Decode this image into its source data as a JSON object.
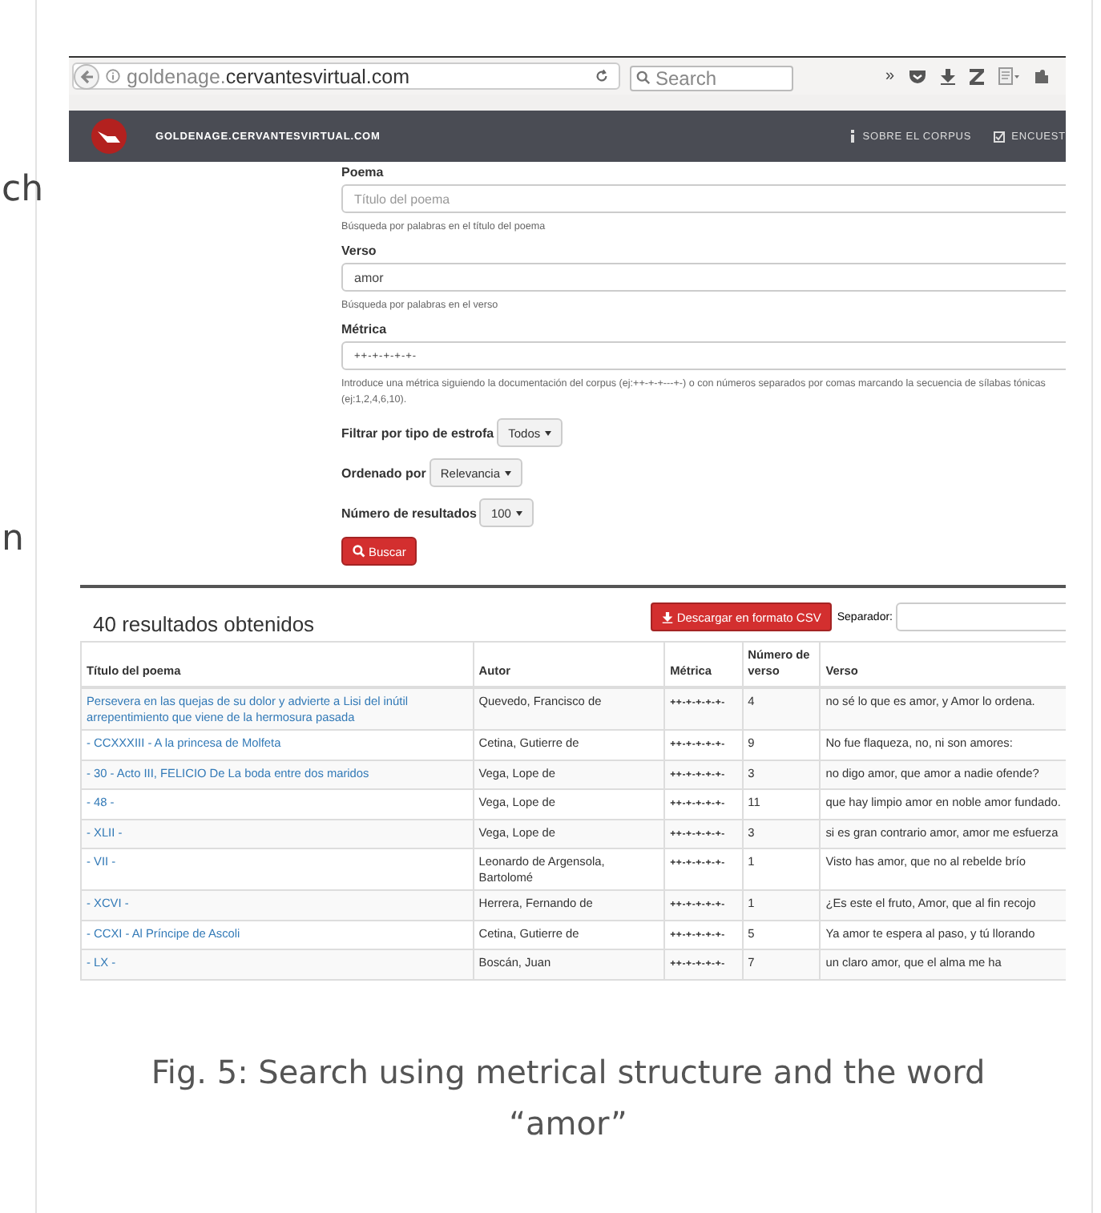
{
  "background_fragments": [
    "ch",
    "n"
  ],
  "browser": {
    "url": {
      "subdomain": "goldenage.",
      "domain": "cervantesvirtual.com"
    },
    "search": {
      "placeholder": "Search"
    },
    "overflow": "»"
  },
  "site_nav": {
    "brand": "GOLDENAGE.CERVANTESVIRTUAL.COM",
    "links": [
      {
        "kind": "info",
        "label": "SOBRE EL CORPUS"
      },
      {
        "kind": "check",
        "label": "ENCUEST"
      }
    ]
  },
  "form": {
    "fields": [
      {
        "label": "Poema",
        "placeholder": "Título del poema",
        "help": "Búsqueda por palabras en el título del poema"
      },
      {
        "label": "Verso",
        "value": "amor",
        "help": "Búsqueda por palabras en el verso"
      },
      {
        "label": "Métrica",
        "value": "++-+-+-+-+-",
        "help": "Introduce una métrica siguiendo la documentación del corpus (ej:++-+-+---+-) o con números separados por comas marcando la secuencia de sílabas tónicas (ej:1,2,4,6,10)."
      }
    ],
    "selects": [
      {
        "label": "Filtrar por tipo de estrofa",
        "value": "Todos"
      },
      {
        "label": "Ordenado por",
        "value": "Relevancia"
      },
      {
        "label": "Número de resultados",
        "value": "100"
      }
    ],
    "submit": "Buscar"
  },
  "results": {
    "count_text": "40 resultados obtenidos",
    "download": "Descargar en formato CSV",
    "separator_label": "Separador:",
    "table": {
      "columns": [
        "Título del poema",
        "Autor",
        "Métrica",
        "Número de verso",
        "Verso"
      ],
      "rows": [
        [
          "Persevera en las quejas de su dolor y advierte a Lisi del inútil arrepentimiento que viene de la hermosura pasada",
          "Quevedo, Francisco de",
          "++-+-+-+-+-",
          "4",
          "no sé lo que es amor, y Amor lo ordena."
        ],
        [
          "- CCXXXIII - A la princesa de Molfeta",
          "Cetina, Gutierre de",
          "++-+-+-+-+-",
          "9",
          "No fue flaqueza, no, ni son amores:"
        ],
        [
          "- 30 - Acto III, FELICIO De La boda entre dos maridos",
          "Vega, Lope de",
          "++-+-+-+-+-",
          "3",
          "no digo amor, que amor a nadie ofende?"
        ],
        [
          "- 48 -",
          "Vega, Lope de",
          "++-+-+-+-+-",
          "11",
          "que hay limpio amor en noble amor fundado."
        ],
        [
          "- XLII -",
          "Vega, Lope de",
          "++-+-+-+-+-",
          "3",
          "si es gran contrario amor, amor me esfuerza"
        ],
        [
          "- VII -",
          "Leonardo de Argensola, Bartolomé",
          "++-+-+-+-+-",
          "1",
          "Visto has amor, que no al rebelde brío"
        ],
        [
          "- XCVI -",
          "Herrera, Fernando de",
          "++-+-+-+-+-",
          "1",
          "¿Es este el fruto, Amor, que al fin recojo"
        ],
        [
          "- CCXI - Al Príncipe de Ascoli",
          "Cetina, Gutierre de",
          "++-+-+-+-+-",
          "5",
          "Ya amor te espera al paso, y tú llorando"
        ],
        [
          "- LX -",
          "Boscán, Juan",
          "++-+-+-+-+-",
          "7",
          "un claro amor, que el alma me ha"
        ]
      ]
    }
  },
  "caption": "Fig. 5: Search using metrical structure and the word “amor”"
}
